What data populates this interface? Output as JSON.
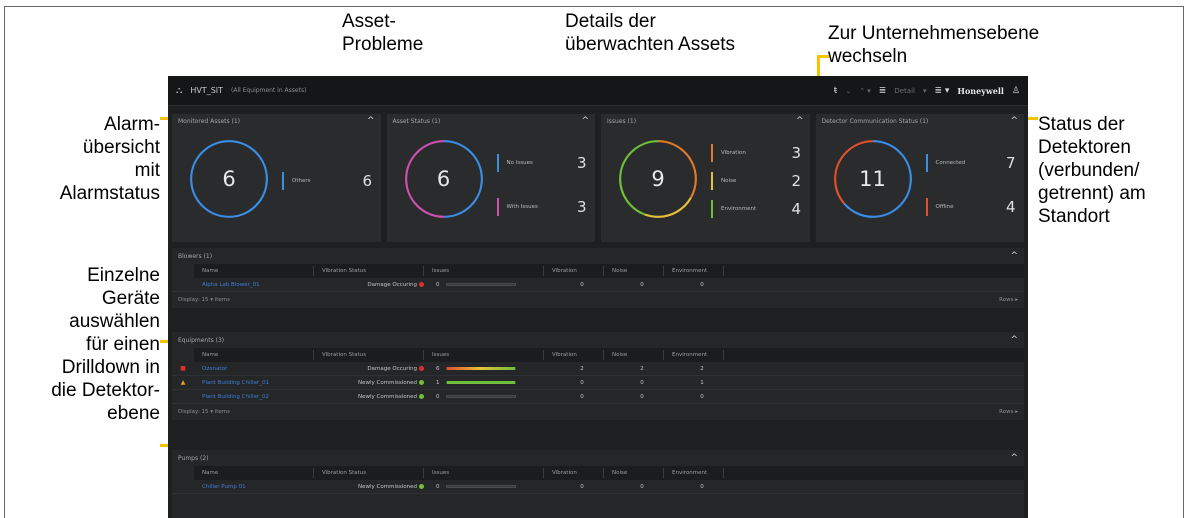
{
  "callouts": {
    "asset_issues": "Asset-\nProbleme",
    "asset_details": "Details der\nüberwachten Assets",
    "enterprise": "Zur Unternehmensebene\nwechseln",
    "alarm_overview": "Alarm-\nübersicht\nmit\nAlarmstatus",
    "detector_status": "Status der\nDetektoren\n(verbunden/\ngetrennt) am\nStandort",
    "select_devices": "Einzelne\nGeräte\nauswählen\nfür einen\nDrilldown in\ndie Detektor-\nebene"
  },
  "topbar": {
    "title": "HVT_SIT",
    "subtitle": "(All Equipment in Assets)",
    "view": "Detail",
    "brand": "Honeywell"
  },
  "cards": [
    {
      "title": "Monitored Assets (1)",
      "total": "6",
      "legend": [
        {
          "label": "Others",
          "value": "6",
          "color": "#3a8ee6"
        }
      ]
    },
    {
      "title": "Asset Status (1)",
      "total": "6",
      "legend": [
        {
          "label": "No Issues",
          "value": "3",
          "color": "#3a8ee6"
        },
        {
          "label": "With Issues",
          "value": "3",
          "color": "#d04fb0"
        }
      ]
    },
    {
      "title": "Issues (1)",
      "total": "9",
      "legend": [
        {
          "label": "Vibration",
          "value": "3",
          "color": "#e07a2c"
        },
        {
          "label": "Noise",
          "value": "2",
          "color": "#e6c23a"
        },
        {
          "label": "Environment",
          "value": "4",
          "color": "#6fbf3a"
        }
      ]
    },
    {
      "title": "Detector Communication Status (1)",
      "total": "11",
      "legend": [
        {
          "label": "Connected",
          "value": "7",
          "color": "#3a8ee6"
        },
        {
          "label": "Offline",
          "value": "4",
          "color": "#e0502c"
        }
      ]
    }
  ],
  "sections": [
    {
      "title": "Blowers (1)",
      "columns": [
        "Name",
        "Vibration Status",
        "Issues",
        "Vibration",
        "Noise",
        "Environment"
      ],
      "rows": [
        {
          "indicator": "",
          "name": "Alpha Lab Blower_01",
          "status": "Damage Occuring",
          "status_color": "#e0302c",
          "issues": "0",
          "issues_fill": 0,
          "vibration": "0",
          "noise": "0",
          "environment": "0"
        }
      ],
      "footer": "Display: 15 ▾ items",
      "rows_label": "Rows"
    },
    {
      "title": "Equipments (3)",
      "columns": [
        "Name",
        "Vibration Status",
        "Issues",
        "Vibration",
        "Noise",
        "Environment"
      ],
      "rows": [
        {
          "indicator": "■",
          "indicator_color": "#e0302c",
          "name": "Ozonator",
          "status": "Damage Occuring",
          "status_color": "#e0302c",
          "issues": "6",
          "issues_fill": 1,
          "vibration": "2",
          "noise": "2",
          "environment": "2"
        },
        {
          "indicator": "▲",
          "indicator_color": "#e6a21a",
          "name": "Plant Building Chiller_01",
          "status": "Newly Commissioned",
          "status_color": "#6fbf3a",
          "issues": "1",
          "issues_fill": 1,
          "vibration": "0",
          "noise": "0",
          "environment": "1"
        },
        {
          "indicator": "",
          "name": "Plant Building Chiller_02",
          "status": "Newly Commissioned",
          "status_color": "#6fbf3a",
          "issues": "0",
          "issues_fill": 0,
          "vibration": "0",
          "noise": "0",
          "environment": "0"
        }
      ],
      "footer": "Display: 15 ▾ items",
      "rows_label": "Rows"
    },
    {
      "title": "Pumps (2)",
      "columns": [
        "Name",
        "Vibration Status",
        "Issues",
        "Vibration",
        "Noise",
        "Environment"
      ],
      "rows": [
        {
          "indicator": "",
          "name": "Chiller Pump 01",
          "status": "Newly Commissioned",
          "status_color": "#6fbf3a",
          "issues": "0",
          "issues_fill": 0,
          "vibration": "0",
          "noise": "0",
          "environment": "0"
        }
      ]
    }
  ]
}
